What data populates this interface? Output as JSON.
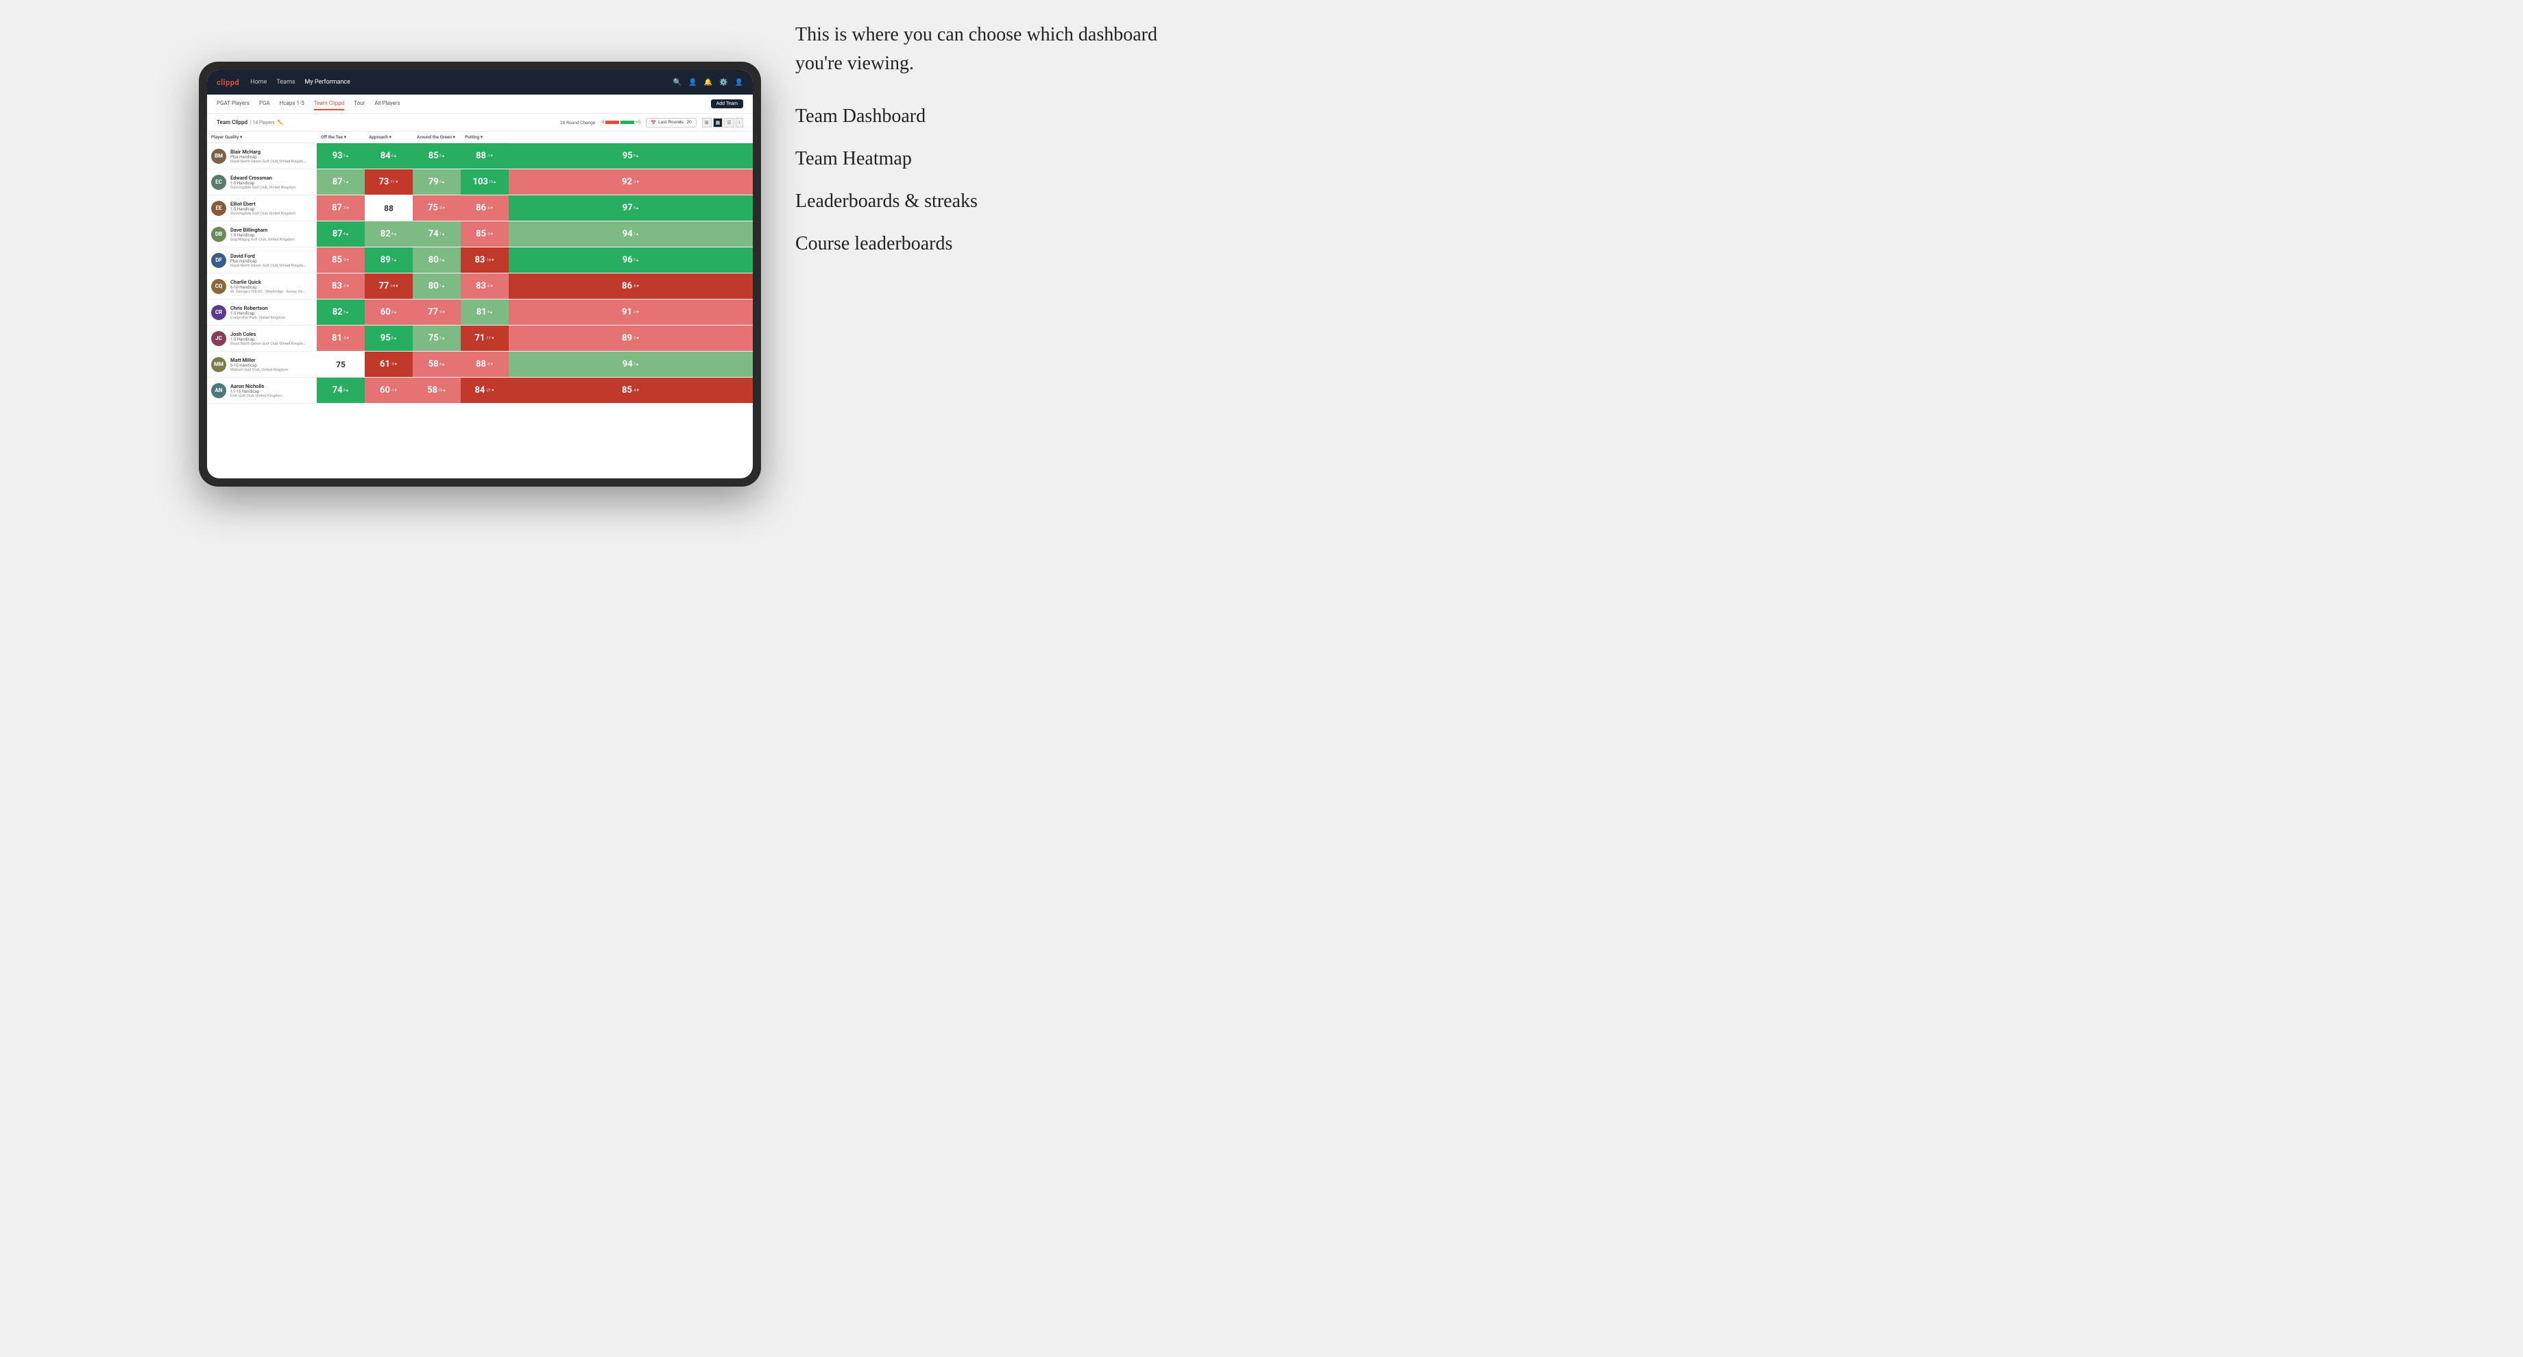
{
  "annotation": {
    "intro_text": "This is where you can choose which dashboard you're viewing.",
    "options": [
      "Team Dashboard",
      "Team Heatmap",
      "Leaderboards & streaks",
      "Course leaderboards"
    ]
  },
  "nav": {
    "logo": "clippd",
    "links": [
      "Home",
      "Teams",
      "My Performance"
    ],
    "active_link": "My Performance"
  },
  "sub_nav": {
    "links": [
      "PGAT Players",
      "PGA",
      "Hcaps 1-5",
      "Team Clippd",
      "Tour",
      "All Players"
    ],
    "active_link": "Team Clippd",
    "add_team_label": "Add Team"
  },
  "team_header": {
    "team_name": "Team Clippd",
    "separator": "|",
    "player_count": "14 Players",
    "round_change_label": "20 Round Change",
    "change_minus": "-5",
    "change_plus": "+5",
    "last_rounds_label": "Last Rounds:",
    "last_rounds_value": "20"
  },
  "table": {
    "columns": {
      "player": "Player Quality ▾",
      "off_tee": "Off the Tee ▾",
      "approach": "Approach ▾",
      "around_green": "Around the Green ▾",
      "putting": "Putting ▾"
    },
    "rows": [
      {
        "name": "Blair McHarg",
        "handicap": "Plus Handicap",
        "club": "Royal North Devon Golf Club, United Kingdom",
        "initials": "BM",
        "avatar_color": "#7a6248",
        "scores": {
          "quality": {
            "value": "93",
            "change": "9▲",
            "bg": "green-dark"
          },
          "off_tee": {
            "value": "84",
            "change": "6▲",
            "bg": "green-dark"
          },
          "approach": {
            "value": "85",
            "change": "8▲",
            "bg": "green-dark"
          },
          "around_green": {
            "value": "88",
            "change": "-1▼",
            "bg": "green-dark"
          },
          "putting": {
            "value": "95",
            "change": "9▲",
            "bg": "green-dark"
          }
        }
      },
      {
        "name": "Edward Crossman",
        "handicap": "1-5 Handicap",
        "club": "Sunningdale Golf Club, United Kingdom",
        "initials": "EC",
        "avatar_color": "#5a7a6a",
        "scores": {
          "quality": {
            "value": "87",
            "change": "1▲",
            "bg": "green-light"
          },
          "off_tee": {
            "value": "73",
            "change": "-11▼",
            "bg": "red-dark"
          },
          "approach": {
            "value": "79",
            "change": "9▲",
            "bg": "green-light"
          },
          "around_green": {
            "value": "103",
            "change": "15▲",
            "bg": "green-dark"
          },
          "putting": {
            "value": "92",
            "change": "-3▼",
            "bg": "red-light"
          }
        }
      },
      {
        "name": "Elliot Ebert",
        "handicap": "1-5 Handicap",
        "club": "Sunningdale Golf Club, United Kingdom",
        "initials": "EE",
        "avatar_color": "#8a5a3a",
        "scores": {
          "quality": {
            "value": "87",
            "change": "-3▼",
            "bg": "red-light"
          },
          "off_tee": {
            "value": "88",
            "change": "",
            "bg": "white"
          },
          "approach": {
            "value": "75",
            "change": "-3▼",
            "bg": "red-light"
          },
          "around_green": {
            "value": "86",
            "change": "-6▼",
            "bg": "red-light"
          },
          "putting": {
            "value": "97",
            "change": "5▲",
            "bg": "green-dark"
          }
        }
      },
      {
        "name": "Dave Billingham",
        "handicap": "1-5 Handicap",
        "club": "Gog Magog Golf Club, United Kingdom",
        "initials": "DB",
        "avatar_color": "#6a8a5a",
        "scores": {
          "quality": {
            "value": "87",
            "change": "4▲",
            "bg": "green-dark"
          },
          "off_tee": {
            "value": "82",
            "change": "4▲",
            "bg": "green-light"
          },
          "approach": {
            "value": "74",
            "change": "1▲",
            "bg": "green-light"
          },
          "around_green": {
            "value": "85",
            "change": "-3▼",
            "bg": "red-light"
          },
          "putting": {
            "value": "94",
            "change": "1▲",
            "bg": "green-light"
          }
        }
      },
      {
        "name": "David Ford",
        "handicap": "Plus Handicap",
        "club": "Royal North Devon Golf Club, United Kingdom",
        "initials": "DF",
        "avatar_color": "#3a5a8a",
        "scores": {
          "quality": {
            "value": "85",
            "change": "-3▼",
            "bg": "red-light"
          },
          "off_tee": {
            "value": "89",
            "change": "7▲",
            "bg": "green-dark"
          },
          "approach": {
            "value": "80",
            "change": "3▲",
            "bg": "green-light"
          },
          "around_green": {
            "value": "83",
            "change": "-10▼",
            "bg": "red-dark"
          },
          "putting": {
            "value": "96",
            "change": "3▲",
            "bg": "green-dark"
          }
        }
      },
      {
        "name": "Charlie Quick",
        "handicap": "6-10 Handicap",
        "club": "St. George's Hill GC - Weybridge - Surrey, Uni...",
        "initials": "CQ",
        "avatar_color": "#8a6a3a",
        "scores": {
          "quality": {
            "value": "83",
            "change": "-3▼",
            "bg": "red-light"
          },
          "off_tee": {
            "value": "77",
            "change": "-14▼",
            "bg": "red-dark"
          },
          "approach": {
            "value": "80",
            "change": "1▲",
            "bg": "green-light"
          },
          "around_green": {
            "value": "83",
            "change": "-6▼",
            "bg": "red-light"
          },
          "putting": {
            "value": "86",
            "change": "-8▼",
            "bg": "red-dark"
          }
        }
      },
      {
        "name": "Chris Robertson",
        "handicap": "1-5 Handicap",
        "club": "Craigmillar Park, United Kingdom",
        "initials": "CR",
        "avatar_color": "#5a3a8a",
        "scores": {
          "quality": {
            "value": "82",
            "change": "3▲",
            "bg": "green-dark"
          },
          "off_tee": {
            "value": "60",
            "change": "2▲",
            "bg": "red-light"
          },
          "approach": {
            "value": "77",
            "change": "-3▼",
            "bg": "red-light"
          },
          "around_green": {
            "value": "81",
            "change": "4▲",
            "bg": "green-light"
          },
          "putting": {
            "value": "91",
            "change": "-3▼",
            "bg": "red-light"
          }
        }
      },
      {
        "name": "Josh Coles",
        "handicap": "1-5 Handicap",
        "club": "Royal North Devon Golf Club, United Kingdom",
        "initials": "JC",
        "avatar_color": "#8a3a5a",
        "scores": {
          "quality": {
            "value": "81",
            "change": "-3▼",
            "bg": "red-light"
          },
          "off_tee": {
            "value": "95",
            "change": "8▲",
            "bg": "green-dark"
          },
          "approach": {
            "value": "75",
            "change": "2▲",
            "bg": "green-light"
          },
          "around_green": {
            "value": "71",
            "change": "-11▼",
            "bg": "red-dark"
          },
          "putting": {
            "value": "89",
            "change": "-2▼",
            "bg": "red-light"
          }
        }
      },
      {
        "name": "Matt Miller",
        "handicap": "6-10 Handicap",
        "club": "Woburn Golf Club, United Kingdom",
        "initials": "MM",
        "avatar_color": "#7a7a4a",
        "scores": {
          "quality": {
            "value": "75",
            "change": "",
            "bg": "white"
          },
          "off_tee": {
            "value": "61",
            "change": "-3▼",
            "bg": "red-dark"
          },
          "approach": {
            "value": "58",
            "change": "4▲",
            "bg": "red-light"
          },
          "around_green": {
            "value": "88",
            "change": "-2▼",
            "bg": "red-light"
          },
          "putting": {
            "value": "94",
            "change": "3▲",
            "bg": "green-light"
          }
        }
      },
      {
        "name": "Aaron Nicholls",
        "handicap": "11-15 Handicap",
        "club": "Drift Golf Club, United Kingdom",
        "initials": "AN",
        "avatar_color": "#4a7a7a",
        "scores": {
          "quality": {
            "value": "74",
            "change": "8▲",
            "bg": "green-dark"
          },
          "off_tee": {
            "value": "60",
            "change": "-1▼",
            "bg": "red-light"
          },
          "approach": {
            "value": "58",
            "change": "10▲",
            "bg": "red-light"
          },
          "around_green": {
            "value": "84",
            "change": "-21▼",
            "bg": "red-dark"
          },
          "putting": {
            "value": "85",
            "change": "-4▼",
            "bg": "red-dark"
          }
        }
      }
    ]
  }
}
